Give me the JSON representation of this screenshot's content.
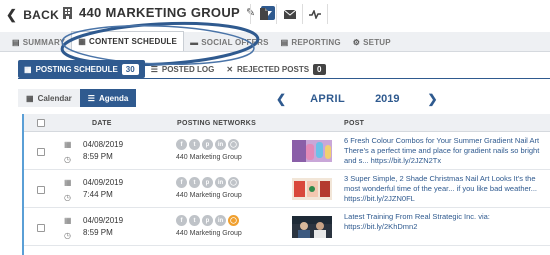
{
  "header": {
    "back_label": "BACK",
    "group_name": "440 MARKETING GROUP"
  },
  "tabs": [
    {
      "label": "SUMMARY",
      "icon": "summary-icon"
    },
    {
      "label": "CONTENT SCHEDULE",
      "icon": "calendar-icon"
    },
    {
      "label": "SOCIAL OFFERS",
      "icon": "ticket-icon"
    },
    {
      "label": "REPORTING",
      "icon": "report-icon"
    },
    {
      "label": "SETUP",
      "icon": "gear-icon"
    }
  ],
  "subtabs": {
    "posting_schedule": {
      "label": "POSTING SCHEDULE",
      "count": "30"
    },
    "posted_log": {
      "label": "POSTED LOG"
    },
    "rejected_posts": {
      "label": "REJECTED POSTS",
      "count": "0"
    }
  },
  "view": {
    "calendar_label": "Calendar",
    "agenda_label": "Agenda",
    "month": "APRIL",
    "year": "2019"
  },
  "table": {
    "columns": {
      "date": "DATE",
      "networks": "POSTING NETWORKS",
      "post": "POST"
    },
    "rows": [
      {
        "date": "04/08/2019",
        "time": "8:59 PM",
        "network_name": "440 Marketing Group",
        "post": "6 Fresh Colour Combos for Your Summer Gradient Nail Art There's a perfect time and place for gradient nails so bright and s... https://bit.ly/2JZN2Tx"
      },
      {
        "date": "04/09/2019",
        "time": "7:44 PM",
        "network_name": "440 Marketing Group",
        "post": "3 Super Simple, 2 Shade Christmas Nail Art Looks It's the most wonderful time of the year... if you like bad weather... https://bit.ly/2JZN0FL"
      },
      {
        "date": "04/09/2019",
        "time": "8:59 PM",
        "network_name": "440 Marketing Group",
        "post": "Latest Training From Real Strategic Inc. via: https://bit.ly/2KhDmn2"
      }
    ]
  },
  "colors": {
    "accent": "#2f5a8f",
    "highlight_ring": "#2f5a8f",
    "active_network": "#f0a030"
  }
}
